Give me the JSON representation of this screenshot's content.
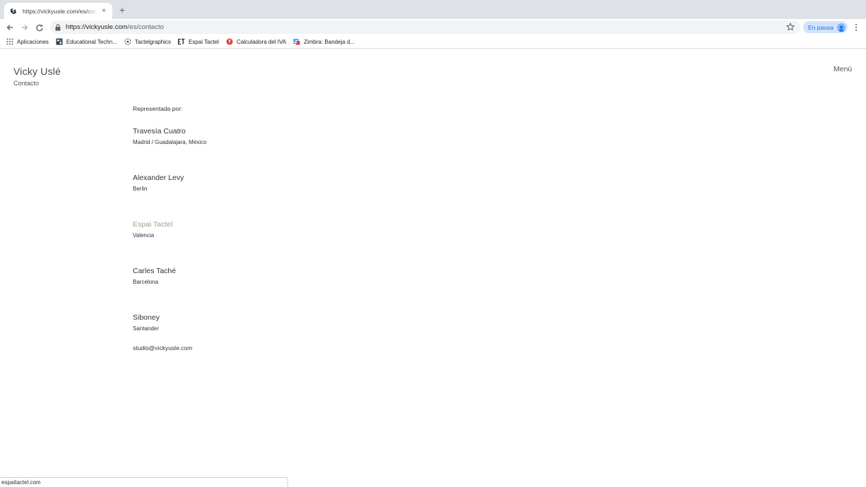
{
  "browser": {
    "tab_title": "https://vickyusle.com/es/contacto",
    "tab_close": "×",
    "new_tab": "+",
    "url_host": "https://vickyusle.com",
    "url_path": "/es/contacto",
    "profile_label": "En pausa",
    "bookmarks": [
      {
        "label": "Aplicaciones",
        "icon": "apps-grid-icon"
      },
      {
        "label": "Educational Techn...",
        "icon": "educational-tech-icon"
      },
      {
        "label": "Tactelgraphics",
        "icon": "tactelgraphics-icon"
      },
      {
        "label": "Espai Tactel",
        "icon": "espai-tactel-icon"
      },
      {
        "label": "Calculadora del IVA",
        "icon": "calculadora-icon"
      },
      {
        "label": "Zimbra: Bandeja d...",
        "icon": "zimbra-icon"
      }
    ],
    "status_url": "espaitactel.com",
    "accent": "#1a73e8"
  },
  "site": {
    "brand": "Vicky Uslé",
    "page_subtitle": "Contacto",
    "menu": "Menú",
    "intro": "Representada por:",
    "galleries": [
      {
        "name": "Travesía Cuatro",
        "city": "Madrid / Guadalajara, México"
      },
      {
        "name": "Alexander Levy",
        "city": "Berlin"
      },
      {
        "name": "Espai Tactel",
        "city": "Valencia",
        "hovered": true
      },
      {
        "name": "Carles Taché",
        "city": "Barcelona"
      },
      {
        "name": "Siboney",
        "city": "Santander"
      }
    ],
    "email": "studio@vickyusle.com",
    "link_hover_color": "#a89d88"
  }
}
